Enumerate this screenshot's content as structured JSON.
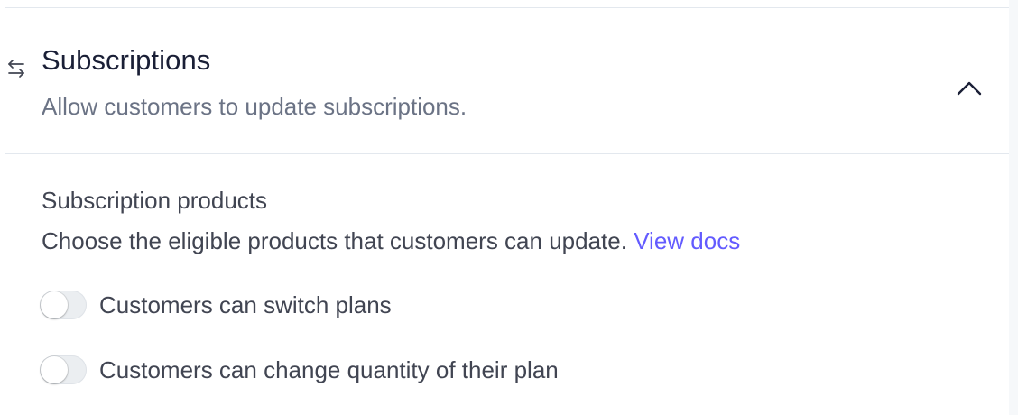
{
  "section": {
    "icon": "swap-arrows-icon",
    "title": "Subscriptions",
    "subtitle": "Allow customers to update subscriptions.",
    "collapse_icon": "chevron-up-icon",
    "expanded": true
  },
  "products": {
    "heading": "Subscription products",
    "description": "Choose the eligible products that customers can update.",
    "link_text": "View docs"
  },
  "toggles": [
    {
      "label": "Customers can switch plans",
      "enabled": false
    },
    {
      "label": "Customers can change quantity of their plan",
      "enabled": false
    }
  ],
  "colors": {
    "link": "#635bff",
    "title": "#1a1f36",
    "subtitle": "#6b7385",
    "body_text": "#414552",
    "divider": "#e3e8ee",
    "toggle_off_track": "#ebeef1"
  }
}
